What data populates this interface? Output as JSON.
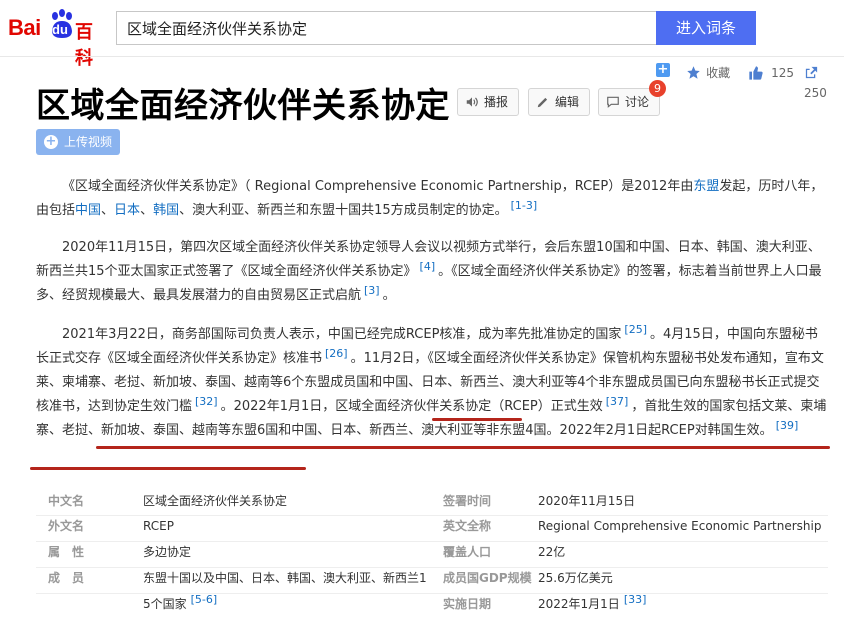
{
  "header": {
    "logo_text": "Bai",
    "logo_du": "du",
    "logo_baike": "百科",
    "search_value": "区域全面经济伙伴关系协定",
    "search_button": "进入词条"
  },
  "actions": {
    "collect": "收藏",
    "like_count": "125",
    "share_count": "250"
  },
  "title": "区域全面经济伙伴关系协定",
  "tools": {
    "broadcast": "播报",
    "edit": "编辑",
    "discuss": "讨论",
    "discuss_badge": "9"
  },
  "upload_label": "上传视频",
  "paragraphs": {
    "p1": {
      "t1": "《区域全面经济伙伴关系协定》（ Regional Comprehensive Economic Partnership，RCEP）是2012年由",
      "asean": "东盟",
      "t2": "发起，历时八年，由包括",
      "china": "中国",
      "sep1": "、",
      "japan": "日本",
      "sep2": "、",
      "korea": "韩国",
      "t3": "、澳大利亚、新西兰和东盟十国共15方成员制定的协定。",
      "ref": "[1-3]"
    },
    "p2": {
      "t1": "2020年11月15日，第四次区域全面经济伙伴关系协定领导人会议以视频方式举行，会后东盟10国和中国、日本、韩国、澳大利亚、新西兰共15个亚太国家正式签署了《区域全面经济伙伴关系协定》",
      "ref1": "[4]",
      "t2": "。《区域全面经济伙伴关系协定》的签署，标志着当前世界上人口最多、经贸规模最大、最具发展潜力的自由贸易区正式启航",
      "ref2": "[3]",
      "t3": "。"
    },
    "p3": {
      "t1": "2021年3月22日，商务部国际司负责人表示，中国已经完成RCEP核准，成为率先批准协定的国家",
      "ref1": "[25]",
      "t2": "。4月15日，中国向东盟秘书长正式交存《区域全面经济伙伴关系协定》核准书",
      "ref2": "[26]",
      "t3": "。11月2日，《区域全面经济伙伴关系协定》保管机构东盟秘书处发布通知，宣布文莱、柬埔寨、老挝、新加坡、泰国、越南等6个东盟成员国和中国、日本、新西兰、澳大利亚等4个非东盟成员国已向东盟秘书长正式提交核准书，达到协定生效门槛",
      "ref3": "[32]",
      "t4": "。2022年1月1日，区域全面经济伙伴关系协定（RCEP）正式生效",
      "ref4": "[37]",
      "t5": "，首批生效的国家包括文莱、柬埔寨、老挝、新加坡、泰国、越南等东盟6国和中国、日本、新西兰、澳大利亚等非东盟4国。2022年2月1日起RCEP对韩国生效。",
      "ref5": "[39]"
    }
  },
  "info": {
    "r1": {
      "l1": "中文名",
      "v1": "区域全面经济伙伴关系协定",
      "l2": "签署时间",
      "v2": "2020年11月15日"
    },
    "r2": {
      "l1": "外文名",
      "v1": "RCEP",
      "l2": "英文全称",
      "v2": "Regional Comprehensive Economic Partnership"
    },
    "r3": {
      "l1": "属　性",
      "v1": "多边协定",
      "l2": "覆盖人口",
      "v2": "22亿"
    },
    "r4": {
      "l1": "成　员",
      "v1": "东盟十国以及中国、日本、韩国、澳大利亚、新西兰1",
      "v1b": "5个国家",
      "v1ref": "[5-6]",
      "l2": "成员国GDP规模",
      "v2": "25.6万亿美元"
    },
    "r5": {
      "l2": "实施日期",
      "v2": "2022年1月1日",
      "v2ref": "[33]"
    }
  },
  "colors": {
    "brand_red": "#e10601",
    "search_blue": "#4e6ef2",
    "link_blue": "#136ec2",
    "annotation_red": "#b4251b"
  }
}
